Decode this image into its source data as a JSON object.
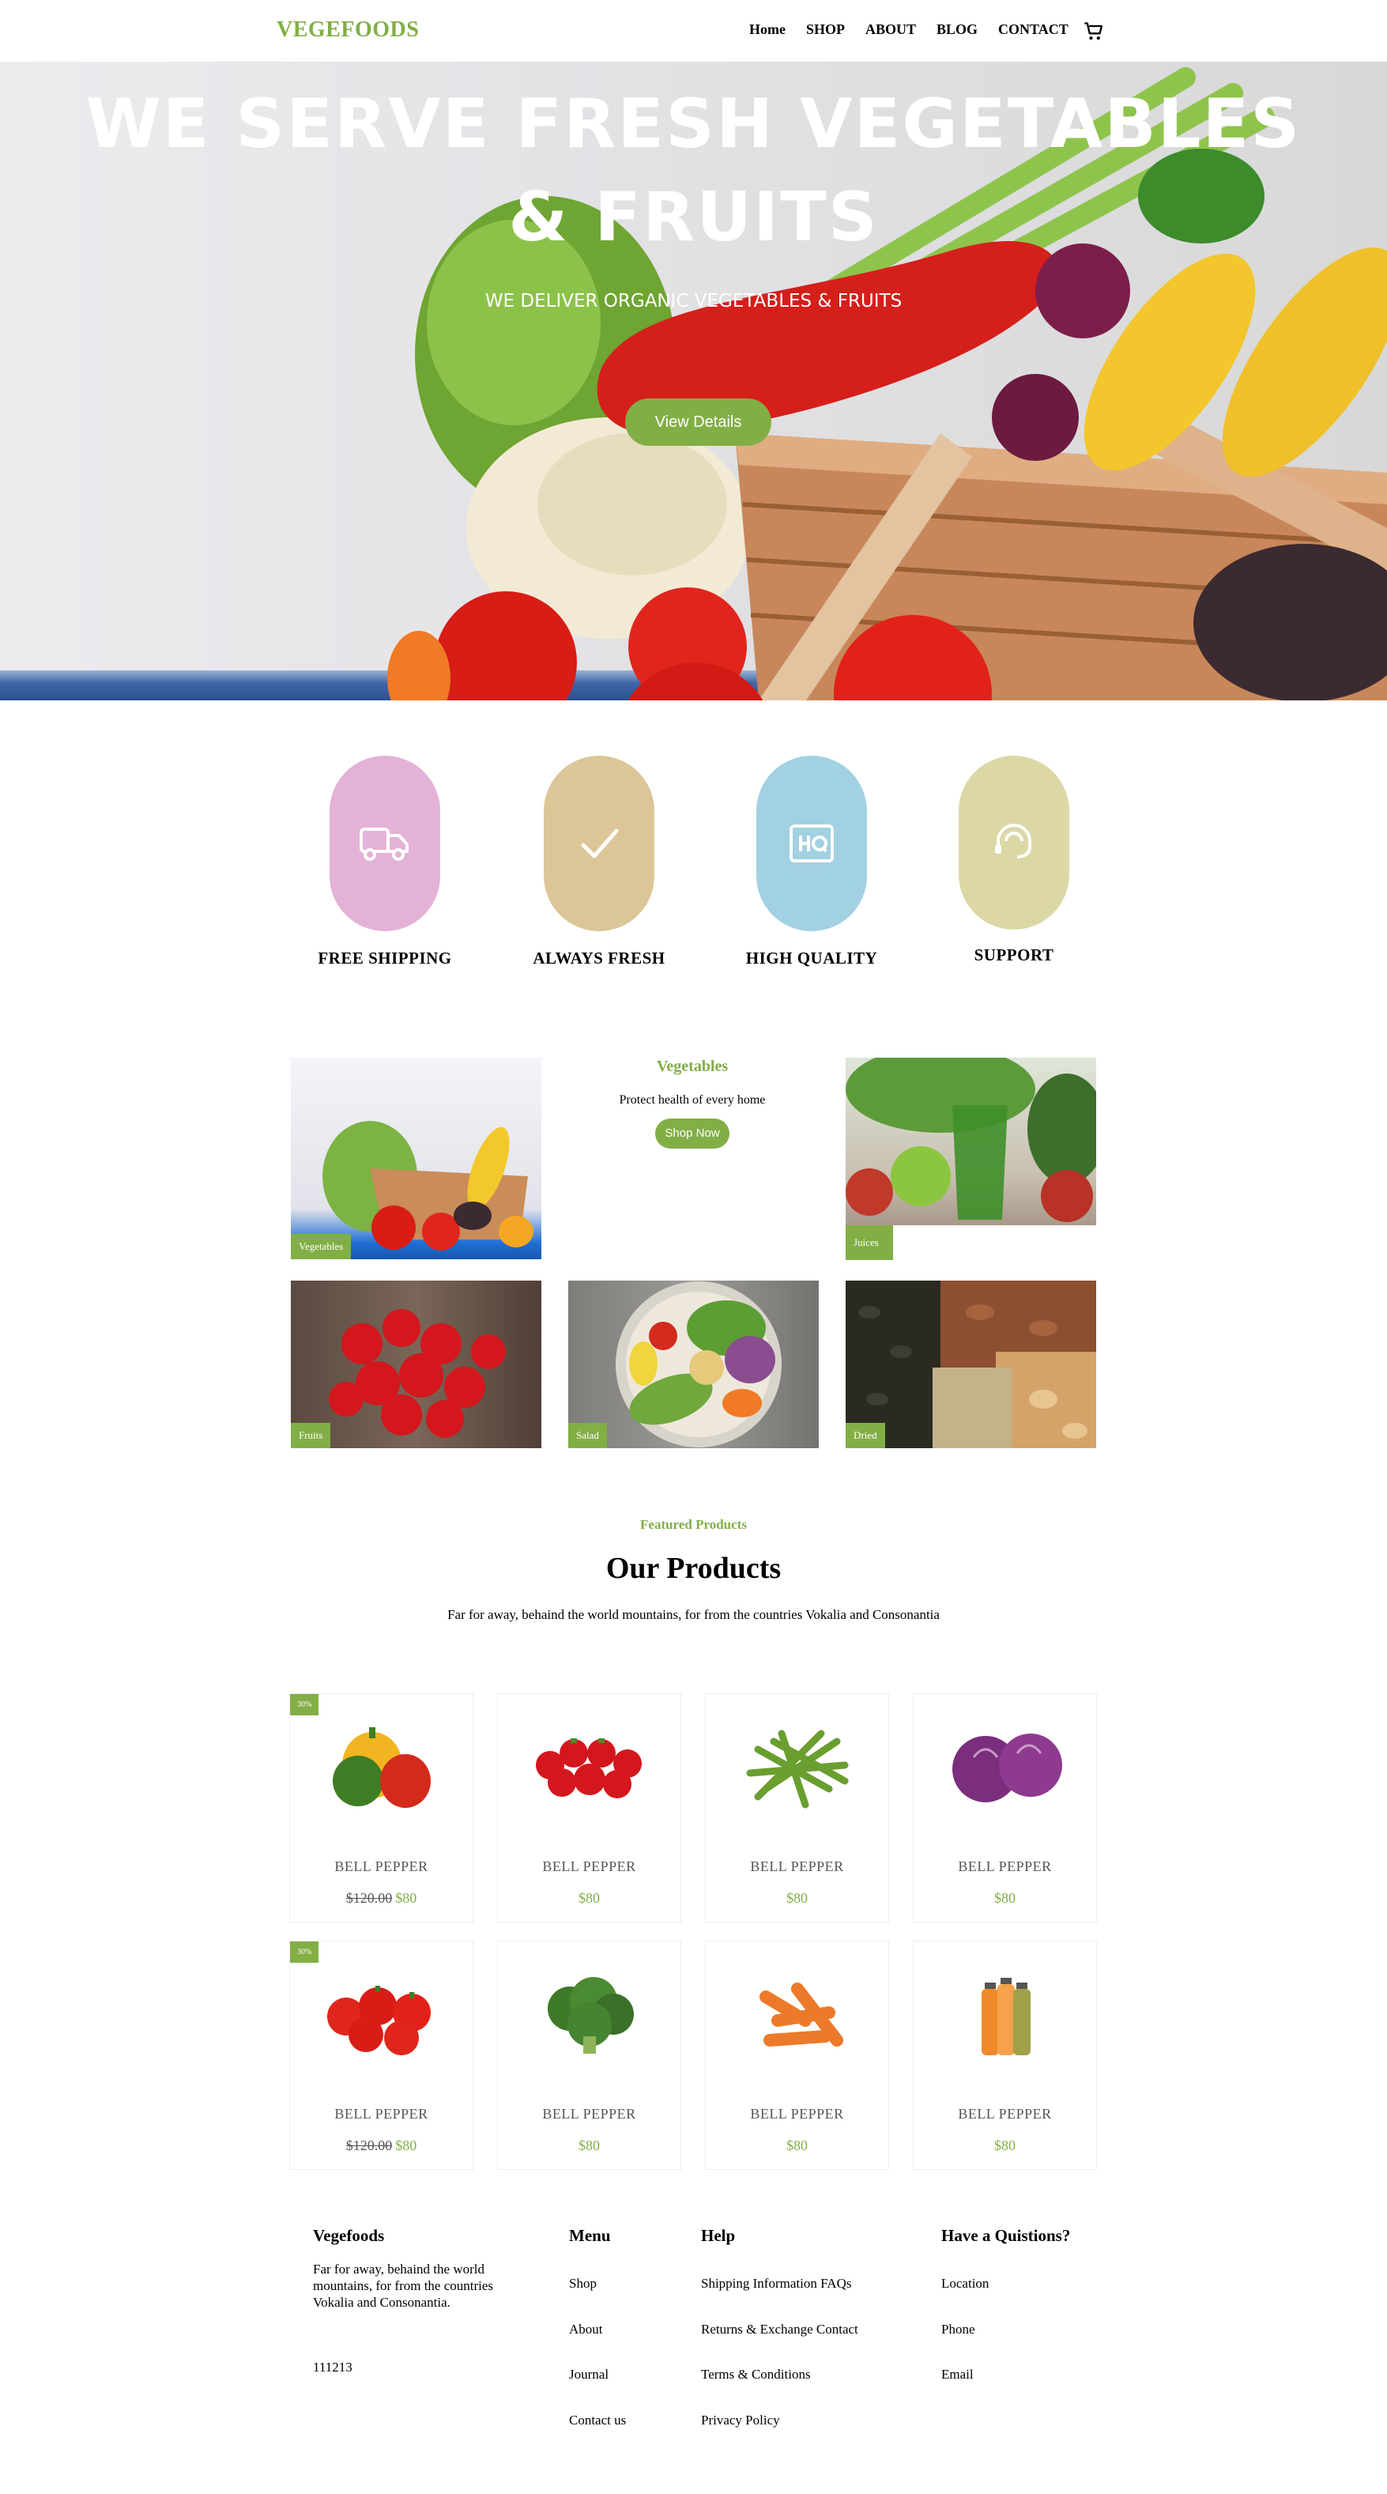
{
  "nav": {
    "brand": "VEGEFOODS",
    "items": [
      "Home",
      "SHOP",
      "ABOUT",
      "BLOG",
      "CONTACT"
    ],
    "cart_icon": "cart-icon"
  },
  "hero": {
    "title_line1": "WE SERVE FRESH VEGETABLES",
    "title_line2": "& FRUITS",
    "subtitle": "WE DELIVER ORGANIC VEGETABLES & FRUITS",
    "button": "View Details"
  },
  "features": [
    {
      "label": "FREE SHIPPING",
      "icon": "truck-icon",
      "color": "#e4b2d6"
    },
    {
      "label": "ALWAYS FRESH",
      "icon": "check-icon",
      "color": "#dcc698"
    },
    {
      "label": "HIGH QUALITY",
      "icon": "hq-icon",
      "color": "#a2d1e1"
    },
    {
      "label": "SUPPORT",
      "icon": "headset-icon",
      "color": "#dcd8a6"
    }
  ],
  "categories": {
    "featured_title": "Vegetables",
    "featured_text": "Protect health of every home",
    "featured_button": "Shop Now",
    "items": [
      "Vegetables",
      "Juices",
      "Fruits",
      "Salad",
      "Dried"
    ]
  },
  "products_section": {
    "subheading": "Featured Products",
    "title": "Our Products",
    "description": "Far for away, behaind the world mountains, for from the countries Vokalia and Consonantia"
  },
  "products": [
    {
      "name": "BELL PEPPER",
      "badge": "30%",
      "old_price": "$120.00",
      "price": "$80",
      "image": "bell-pepper"
    },
    {
      "name": "BELL PEPPER",
      "badge": "",
      "old_price": "",
      "price": "$80",
      "image": "strawberry"
    },
    {
      "name": "BELL PEPPER",
      "badge": "",
      "old_price": "",
      "price": "$80",
      "image": "green-beans"
    },
    {
      "name": "BELL PEPPER",
      "badge": "",
      "old_price": "",
      "price": "$80",
      "image": "purple-cabbage"
    },
    {
      "name": "BELL PEPPER",
      "badge": "30%",
      "old_price": "$120.00",
      "price": "$80",
      "image": "tomatoes"
    },
    {
      "name": "BELL PEPPER",
      "badge": "",
      "old_price": "",
      "price": "$80",
      "image": "broccoli"
    },
    {
      "name": "BELL PEPPER",
      "badge": "",
      "old_price": "",
      "price": "$80",
      "image": "carrots"
    },
    {
      "name": "BELL PEPPER",
      "badge": "",
      "old_price": "",
      "price": "$80",
      "image": "juice-bottles"
    }
  ],
  "footer": {
    "brand": "Vegefoods",
    "about": "Far for away, behaind the world mountains, for from the countries Vokalia and Consonantia.",
    "code": "111213",
    "menu_title": "Menu",
    "menu": [
      "Shop",
      "About",
      "Journal",
      "Contact us"
    ],
    "help_title": "Help",
    "help": [
      "Shipping Information FAQs",
      "Returns & Exchange Contact",
      "Terms & Conditions",
      "Privacy Policy"
    ],
    "contact_title": "Have a Quistions?",
    "contact": [
      "Location",
      "Phone",
      "Email"
    ]
  },
  "colors": {
    "accent": "#82ae46"
  }
}
